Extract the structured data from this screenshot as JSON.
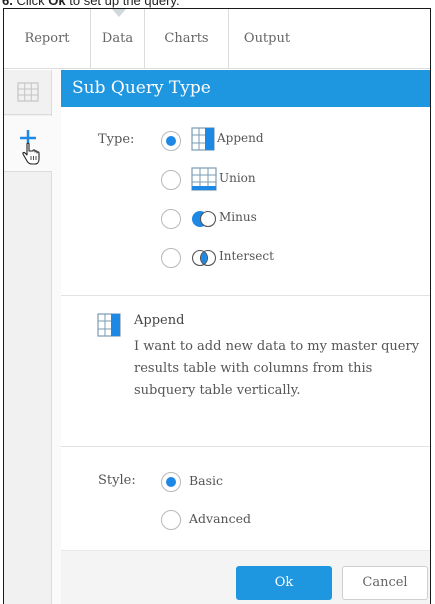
{
  "instruction": {
    "step": "6.",
    "pre": "Click",
    "bold": "Ok",
    "post": "to set up the query."
  },
  "tabs": [
    {
      "label": "Report"
    },
    {
      "label": "Data",
      "active": true
    },
    {
      "label": "Charts"
    },
    {
      "label": "Output"
    }
  ],
  "sidebar": {
    "items": [
      {
        "icon": "grid-icon"
      },
      {
        "icon": "add-icon"
      }
    ]
  },
  "dialog": {
    "title": "Sub Query Type",
    "type_label": "Type:",
    "options": [
      {
        "label": "Append",
        "icon": "append-icon",
        "selected": true
      },
      {
        "label": "Union",
        "icon": "union-icon",
        "selected": false
      },
      {
        "label": "Minus",
        "icon": "minus-icon",
        "selected": false
      },
      {
        "label": "Intersect",
        "icon": "intersect-icon",
        "selected": false
      }
    ],
    "description": {
      "title": "Append",
      "text": "I want to add new data to my master query results table with columns from this subquery table vertically."
    },
    "style_label": "Style:",
    "style_options": [
      {
        "label": "Basic",
        "selected": true
      },
      {
        "label": "Advanced",
        "selected": false
      }
    ],
    "ok_label": "Ok",
    "cancel_label": "Cancel"
  },
  "colors": {
    "accent": "#1e96e0",
    "radio_selected": "#1e88e5",
    "border": "#dcdcdc"
  }
}
